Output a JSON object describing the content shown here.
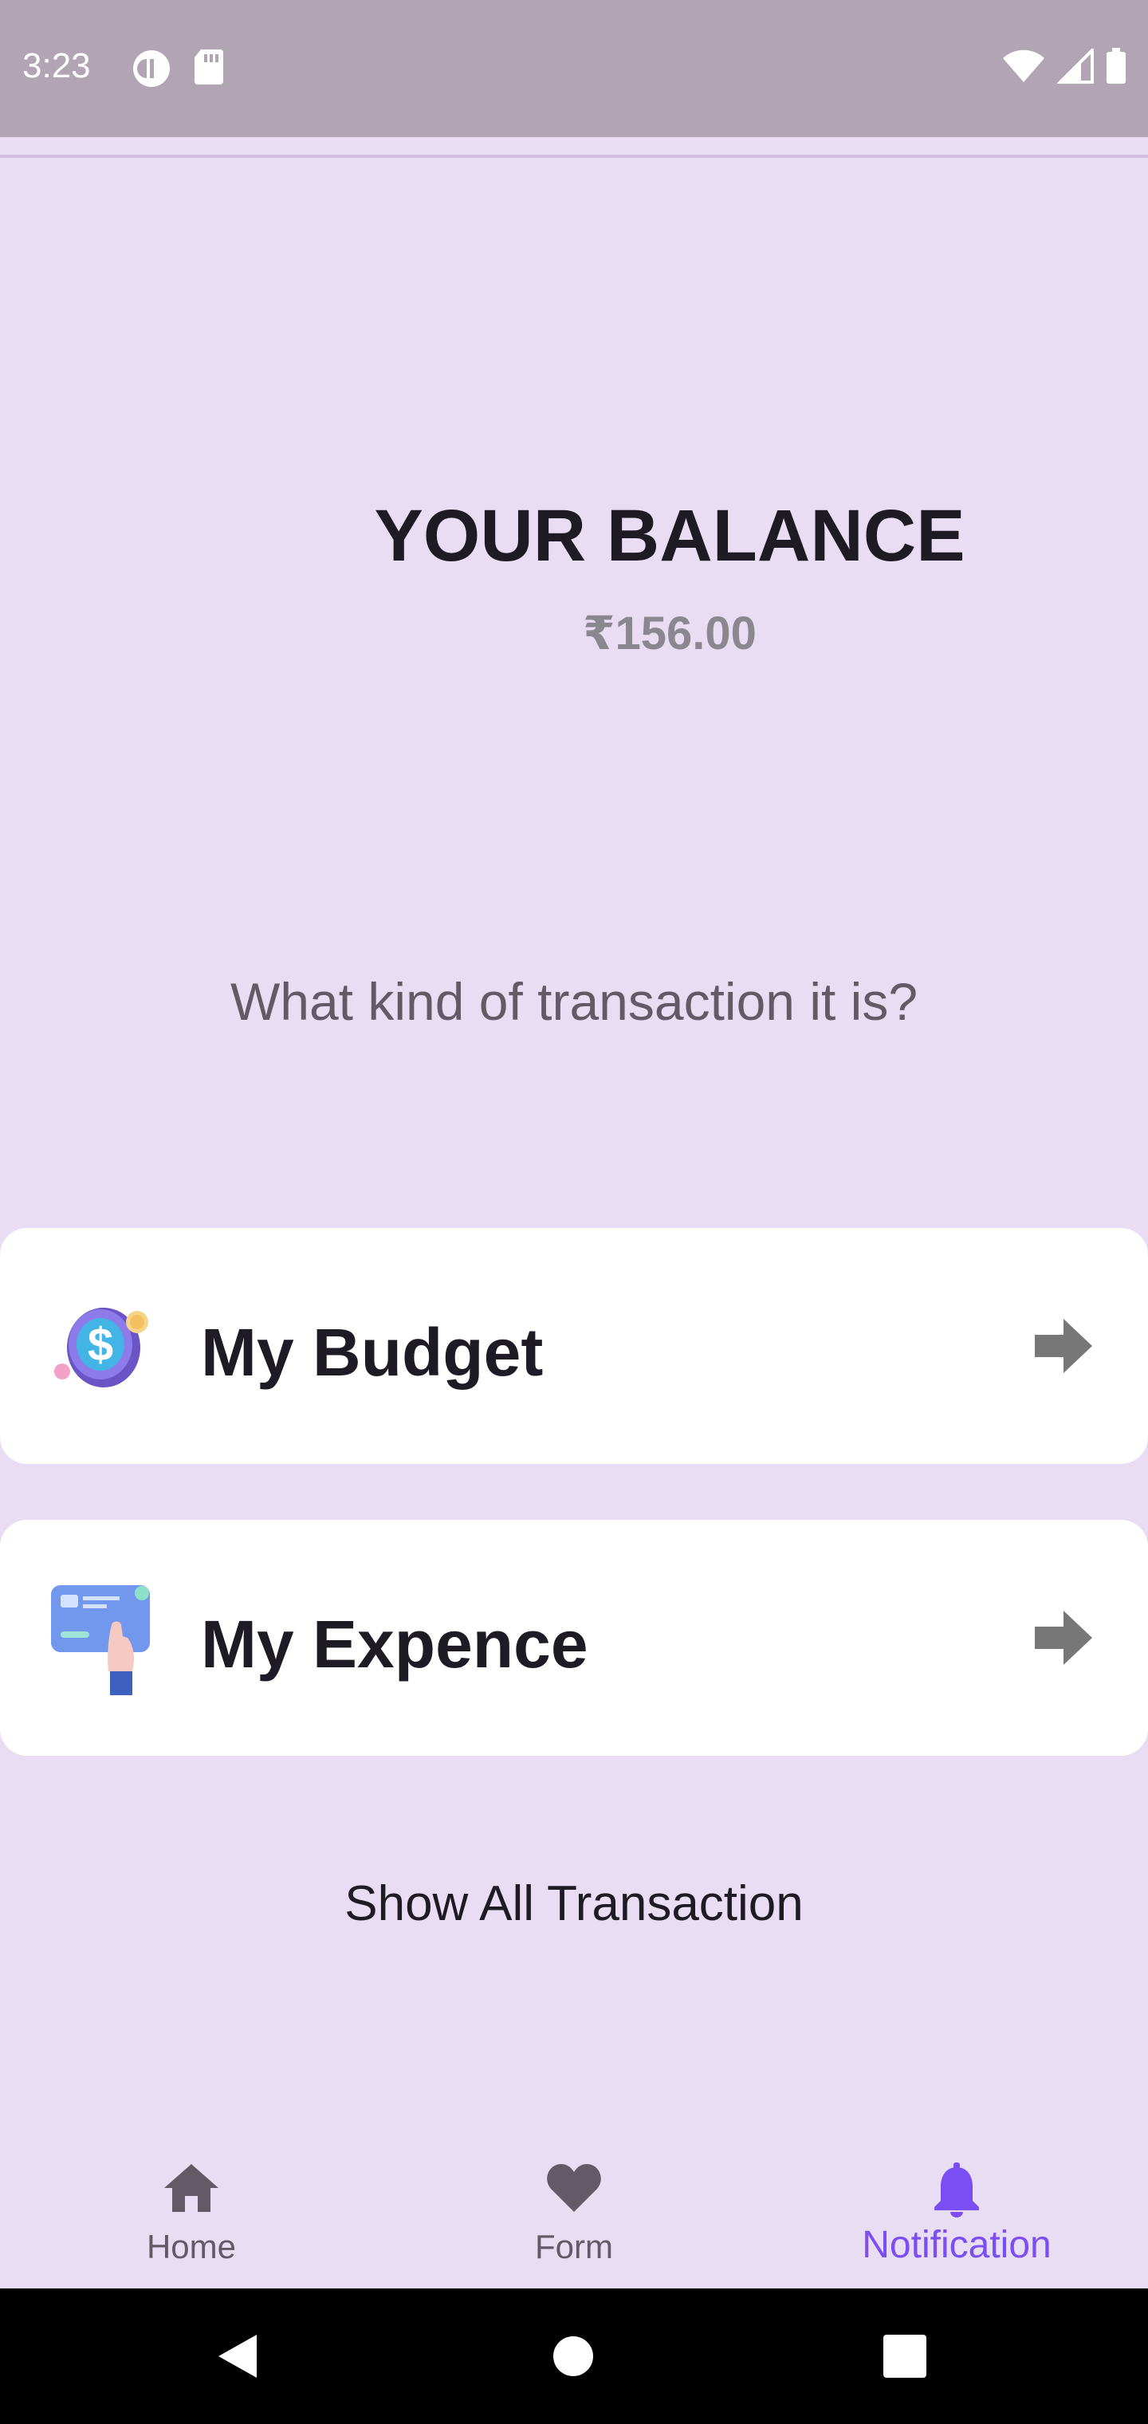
{
  "status_bar": {
    "time": "3:23"
  },
  "main": {
    "balance_title": "YOUR BALANCE",
    "balance_amount": "₹156.00",
    "question": "What kind of transaction it is?",
    "cards": [
      {
        "label": "My Budget",
        "icon": "money-coin-icon"
      },
      {
        "label": "My Expence",
        "icon": "credit-card-hand-icon"
      }
    ],
    "show_all_label": "Show All Transaction"
  },
  "bottom_nav": {
    "items": [
      {
        "label": "Home",
        "icon": "home-icon",
        "active": false
      },
      {
        "label": "Form",
        "icon": "heart-icon",
        "active": false
      },
      {
        "label": "Notification",
        "icon": "bell-icon",
        "active": true
      }
    ]
  },
  "colors": {
    "accent": "#7b4ef3",
    "background": "#e9ddf3",
    "status_bar": "#b1a4b3",
    "card": "#ffffff"
  }
}
